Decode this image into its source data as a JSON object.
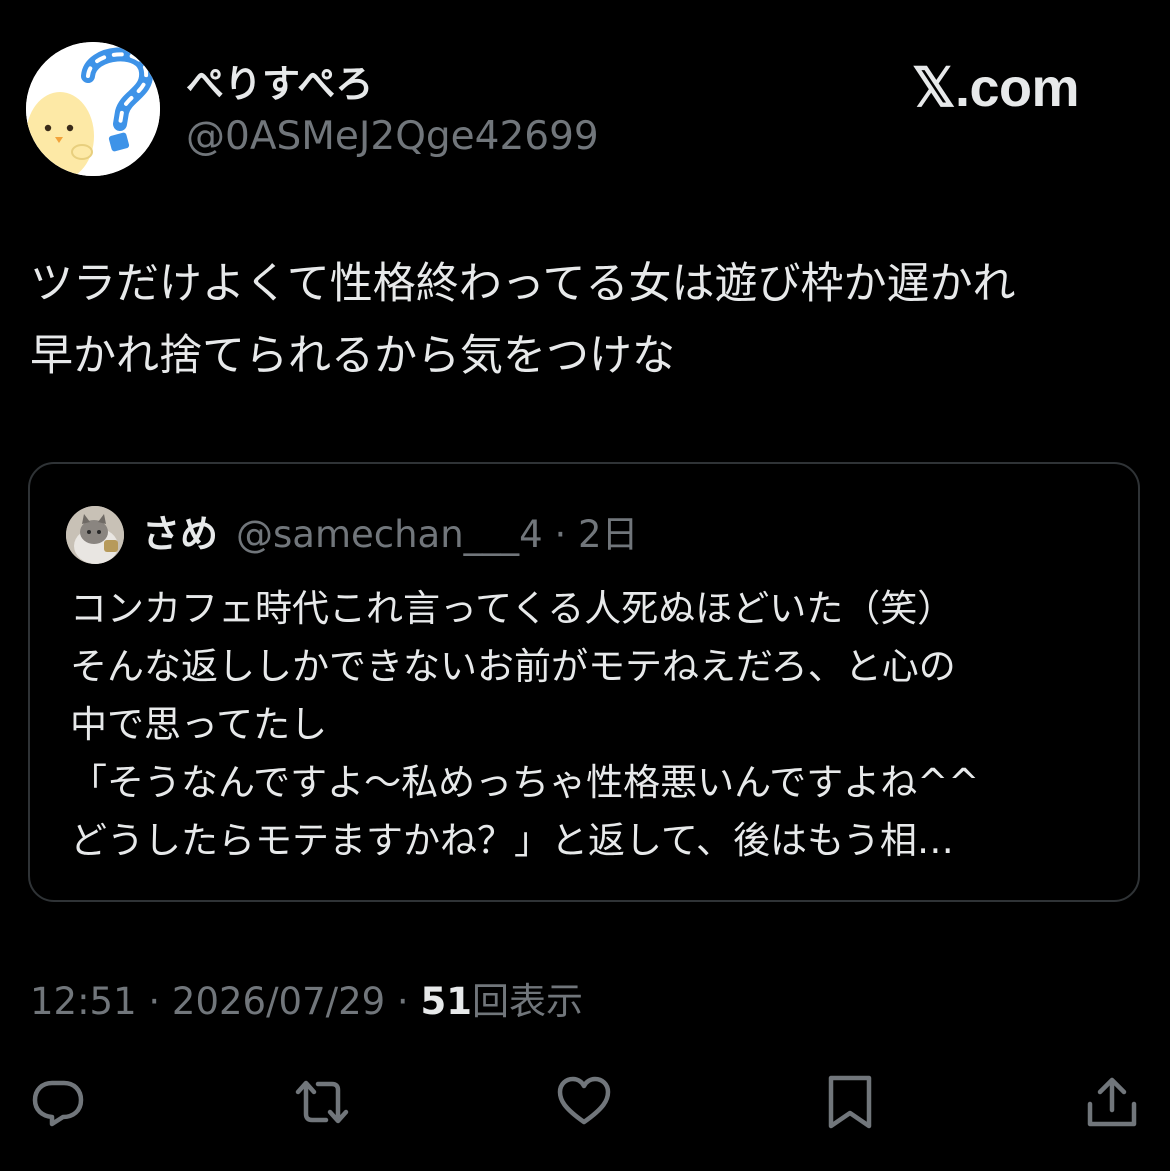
{
  "header": {
    "display_name": "ぺりすぺろ",
    "handle": "@0ASMeJ2Qge42699",
    "brand": "𝕏.com"
  },
  "post": {
    "lines": [
      "ツラだけよくて性格終わってる女は遊び枠か遅かれ",
      "早かれ捨てられるから気をつけな"
    ]
  },
  "quote": {
    "name": "さめ",
    "handle_date": "@samechan___4 · 2日",
    "lines": [
      "コンカフェ時代これ言ってくる人死ぬほどいた（笑）",
      "そんな返ししかできないお前がモテねえだろ、と心の",
      "中で思ってたし",
      "「そうなんですよ〜私めっちゃ性格悪いんですよね^^",
      "どうしたらモテますかね？」と返して、後はもう相…"
    ]
  },
  "meta": {
    "time_date": "12:51 · 2026/07/29 · ",
    "views_count": "51",
    "views_label": "回表示"
  },
  "actions": {
    "reply_icon": "reply-icon",
    "repost_icon": "repost-icon",
    "like_icon": "heart-icon",
    "bookmark_icon": "bookmark-icon",
    "share_icon": "share-icon"
  },
  "colors": {
    "background": "#000000",
    "text": "#e7e9ea",
    "secondary": "#71767b",
    "border": "#2f3336",
    "avatar_accent": "#3e93e8",
    "chick_yellow": "#fde9a6"
  }
}
